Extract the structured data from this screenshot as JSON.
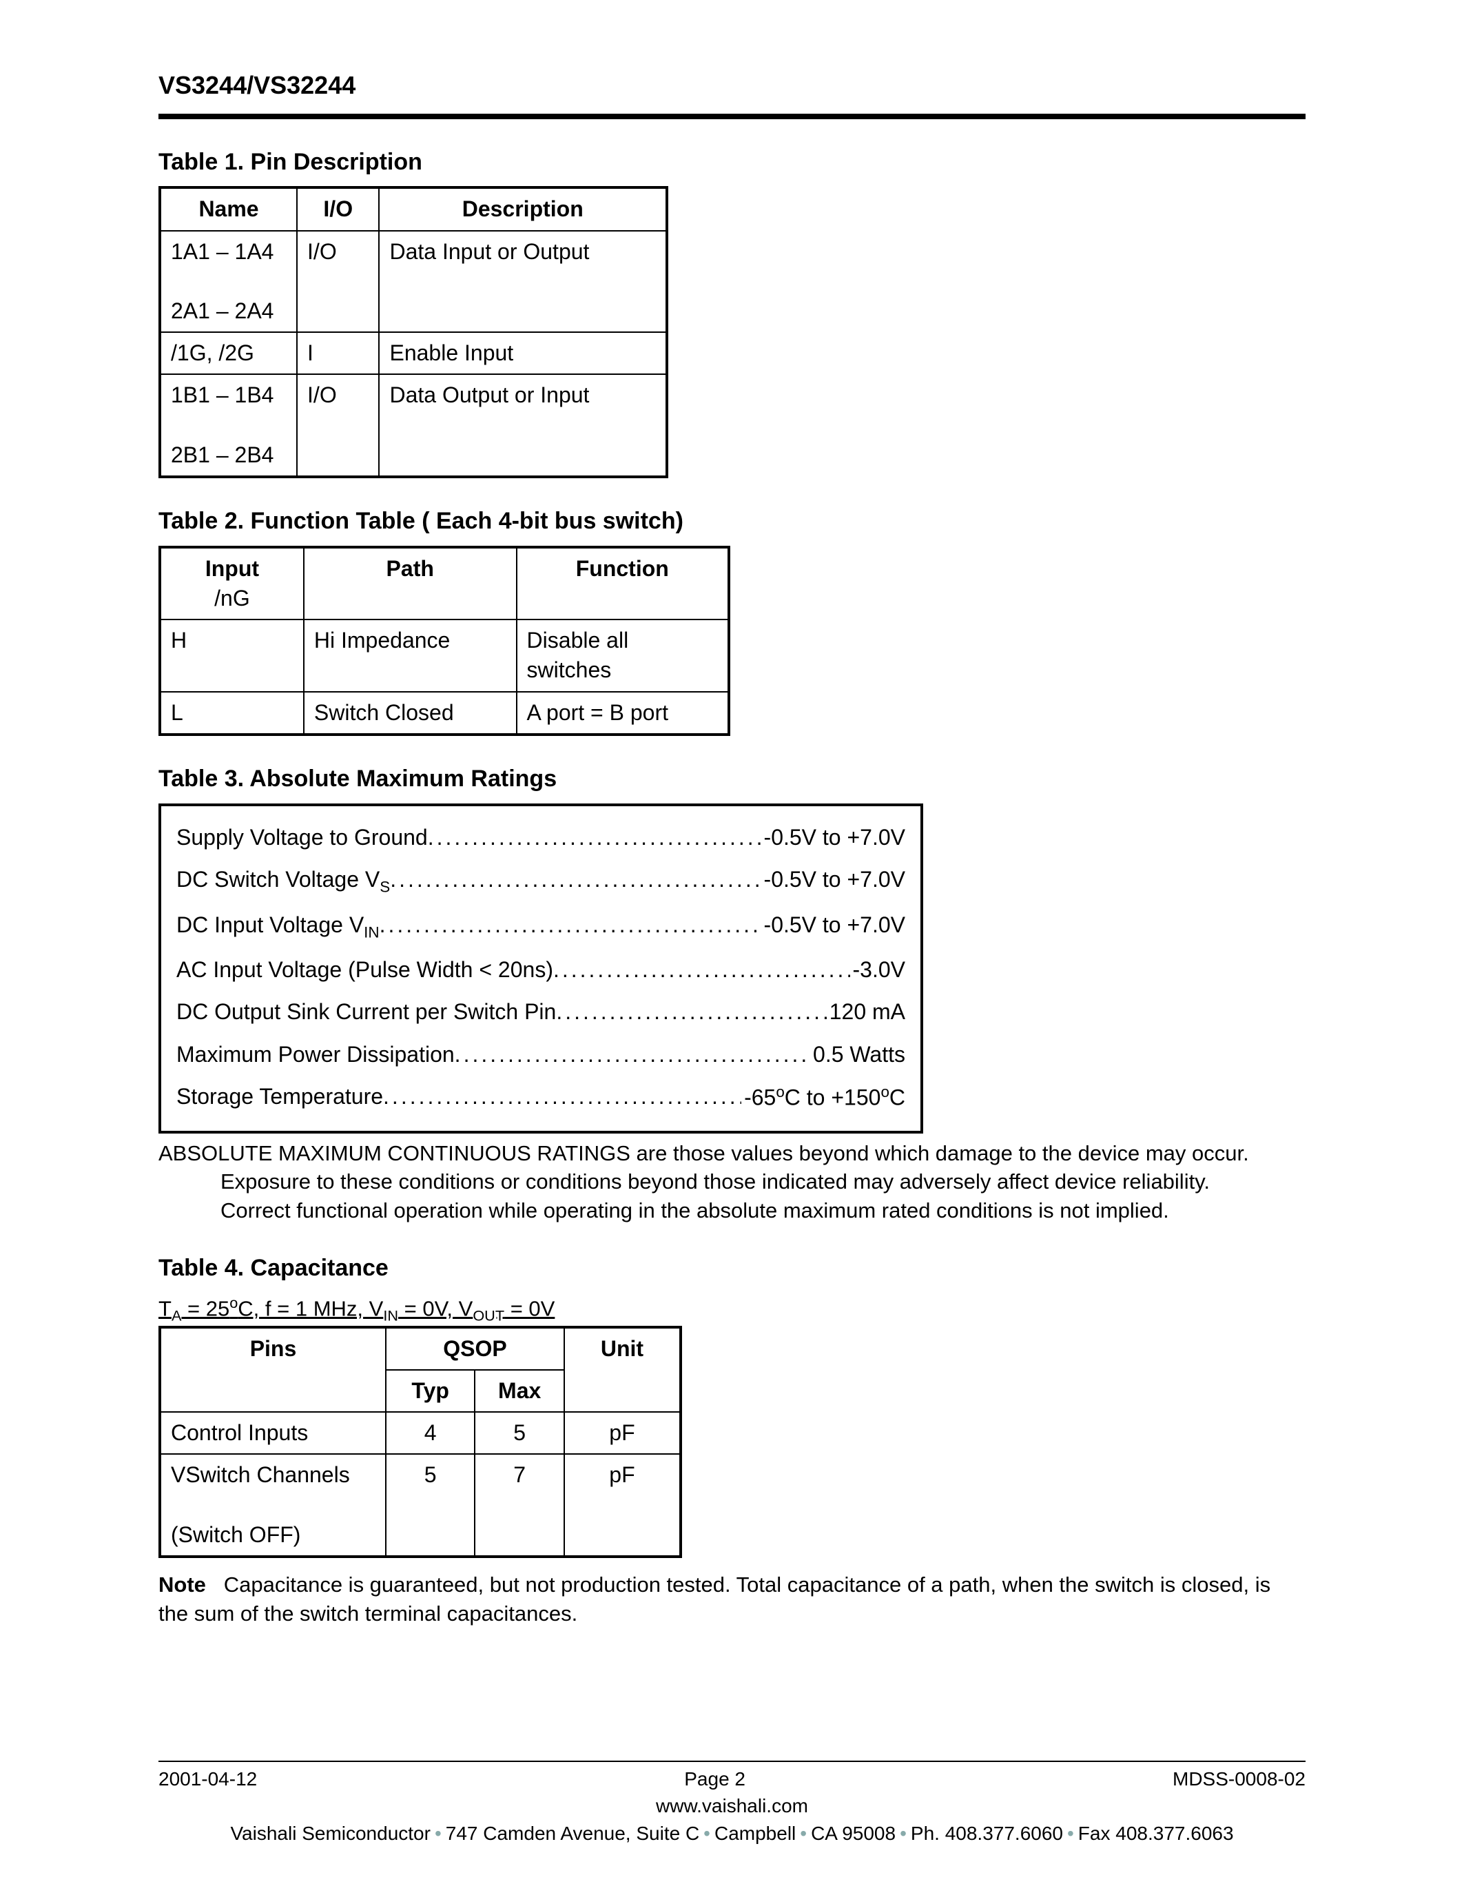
{
  "header": {
    "title": "VS3244/VS32244"
  },
  "table1": {
    "title": "Table 1.  Pin Description",
    "headers": [
      "Name",
      "I/O",
      "Description"
    ],
    "rows": [
      {
        "name_a": "1A1 – 1A4",
        "name_b": "2A1 – 2A4",
        "io": "I/O",
        "desc": "Data Input or Output"
      },
      {
        "name_a": "/1G, /2G",
        "name_b": "",
        "io": "I",
        "desc": "Enable Input"
      },
      {
        "name_a": "1B1 – 1B4",
        "name_b": "2B1 – 2B4",
        "io": "I/O",
        "desc": "Data Output or Input"
      }
    ]
  },
  "table2": {
    "title": "Table 2.  Function Table ( Each 4-bit bus switch)",
    "headers": {
      "input": "Input",
      "input_sub": "/nG",
      "path": "Path",
      "func": "Function"
    },
    "rows": [
      {
        "input": "H",
        "path": "Hi Impedance",
        "func": "Disable all switches"
      },
      {
        "input": "L",
        "path": "Switch Closed",
        "func": "A port = B port"
      }
    ]
  },
  "table3": {
    "title": "Table 3.  Absolute Maximum Ratings",
    "rows": [
      {
        "label": "Supply Voltage to Ground",
        "value": "-0.5V to +7.0V"
      },
      {
        "label": "DC Switch Voltage V",
        "label_sub": "S",
        "value": "-0.5V to +7.0V"
      },
      {
        "label": "DC Input Voltage V",
        "label_sub": "IN",
        "value": "-0.5V to +7.0V"
      },
      {
        "label": "AC Input Voltage (Pulse Width < 20ns)",
        "value": "-3.0V"
      },
      {
        "label": "DC Output Sink Current per Switch Pin",
        "value": "120 mA"
      },
      {
        "label": "Maximum Power Dissipation",
        "value": "0.5 Watts"
      },
      {
        "label": "Storage Temperature",
        "value_html": "-65°C to +150°C"
      }
    ],
    "note_line1": "ABSOLUTE MAXIMUM CONTINUOUS RATINGS are those values beyond which damage to the device may occur.",
    "note_line2": "Exposure to these conditions or conditions beyond those indicated may adversely affect device reliability.",
    "note_line3": "Correct functional operation while operating in the absolute maximum rated conditions is not implied."
  },
  "table4": {
    "title": "Table 4.  Capacitance",
    "conditions_html": "T<sub>A</sub> = 25°C, f = 1 MHz, V<sub>IN</sub> = 0V, V<sub>OUT</sub> = 0V",
    "col_group": "QSOP",
    "headers": {
      "pins": "Pins",
      "typ": "Typ",
      "max": "Max",
      "unit": "Unit"
    },
    "rows": [
      {
        "pins_a": "Control Inputs",
        "pins_b": "",
        "typ": "4",
        "max": "5",
        "unit": "pF"
      },
      {
        "pins_a": "VSwitch Channels",
        "pins_b": "(Switch OFF)",
        "typ": "5",
        "max": "7",
        "unit": "pF"
      }
    ],
    "note_label": "Note",
    "note_text": "Capacitance is guaranteed, but not production tested. Total capacitance of a path, when the switch is closed, is the sum of the switch terminal capacitances."
  },
  "footer": {
    "date": "2001-04-12",
    "page": "Page 2",
    "doc_id": "MDSS-0008-02",
    "url": "www.vaishali.com",
    "addr_parts": [
      "Vaishali Semiconductor",
      "747 Camden Avenue, Suite C",
      "Campbell",
      "CA 95008",
      "Ph. 408.377.6060",
      "Fax 408.377.6063"
    ]
  }
}
